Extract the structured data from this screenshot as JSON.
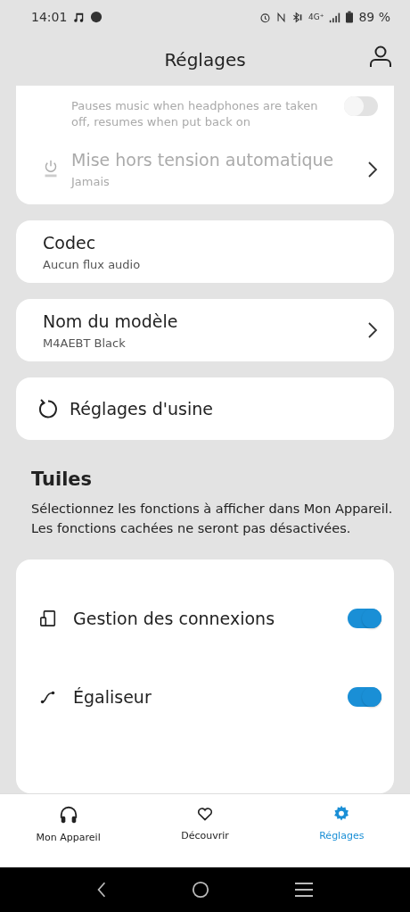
{
  "status_bar": {
    "time": "14:01",
    "network": "4G⁺",
    "battery": "89 %"
  },
  "header": {
    "title": "Réglages"
  },
  "top_card": [
    {
      "kind": "toggle",
      "description": "Pauses music when headphones are taken off, resumes when put back on",
      "on": false,
      "disabled": true
    },
    {
      "kind": "link",
      "title": "Mise hors tension automatique",
      "subtitle": "Jamais",
      "disabled": true
    }
  ],
  "cards": [
    {
      "kind": "info",
      "title": "Codec",
      "subtitle": "Aucun flux audio"
    },
    {
      "kind": "link",
      "title": "Nom du modèle",
      "subtitle": "M4AEBT Black"
    },
    {
      "kind": "reset",
      "title": "Réglages d'usine"
    }
  ],
  "tiles_section": {
    "title": "Tuiles",
    "description": "Sélectionnez les fonctions à afficher dans Mon Appareil. Les fonctions cachées ne seront pas désactivées.",
    "tiles": [
      {
        "kind": "connections",
        "label": "Gestion des connexions",
        "on": true
      },
      {
        "kind": "equalizer",
        "label": "Égaliseur",
        "on": true
      }
    ]
  },
  "bottom_nav": [
    {
      "kind": "device",
      "label": "Mon Appareil",
      "selected": false
    },
    {
      "kind": "discover",
      "label": "Découvrir",
      "selected": false
    },
    {
      "kind": "settings",
      "label": "Réglages",
      "selected": true
    }
  ]
}
